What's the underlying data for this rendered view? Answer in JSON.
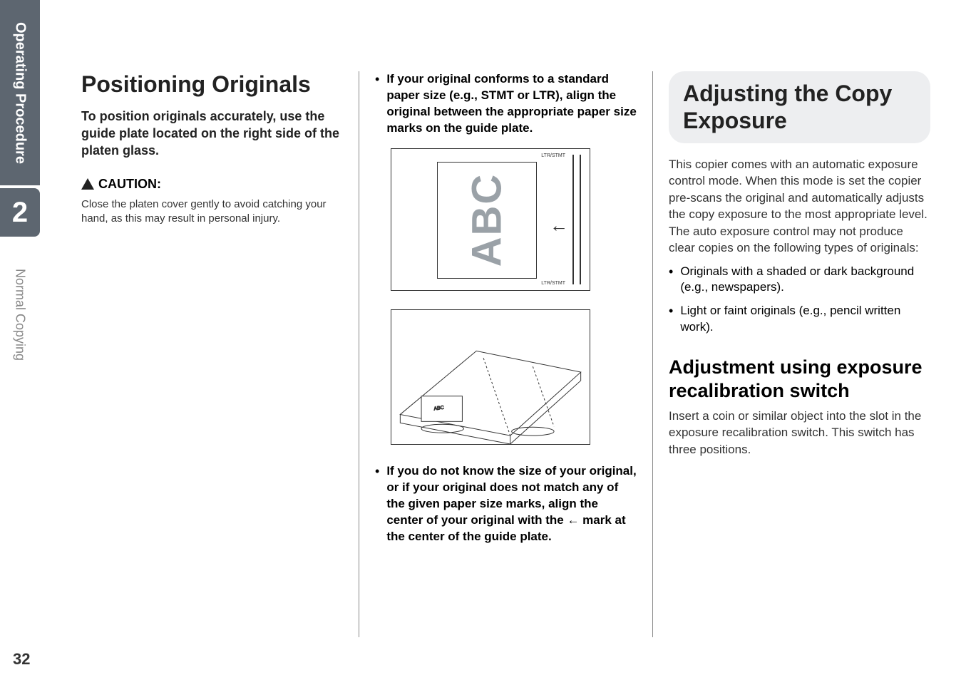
{
  "sidebar": {
    "tab_dark": "Operating Procedure",
    "chapter_number": "2",
    "tab_light": "Normal Copying"
  },
  "page_number": "32",
  "col1": {
    "heading": "Positioning Originals",
    "intro": "To position originals accurately, use the  guide plate located on the right side of the platen glass.",
    "caution_label": "CAUTION:",
    "caution_body": "Close the platen cover gently to avoid catching your hand, as this may result in personal injury."
  },
  "col2": {
    "bullet1": "If your original conforms to a standard paper size (e.g., STMT or LTR), align the original between the appropriate paper size marks on the guide plate.",
    "illus1": {
      "abc_text": "ABC",
      "arrow": "←",
      "marks_top": "LTR/STMT",
      "marks_bot": "LTR/STMT"
    },
    "bullet2_prefix": "If you do not know the size of your original, or if your original does not match any of the given paper size marks, align the center of your original with the ",
    "bullet2_arrow": "←",
    "bullet2_suffix": " mark at the center of the guide plate."
  },
  "col3": {
    "heading": "Adjusting the Copy Exposure",
    "body1": "This copier comes with an automatic exposure control mode. When this mode is set the copier pre-scans the original and automatically adjusts the copy exposure to the most appropriate level. The auto exposure control may not produce clear copies on the following types of originals:",
    "list1": "Originals with a shaded or dark background (e.g., newspapers).",
    "list2": "Light or faint originals (e.g., pencil written work).",
    "subheading": "Adjustment using exposure recalibration switch",
    "body2": "Insert a coin or similar object into the slot in the exposure recalibration switch. This switch has three positions."
  }
}
